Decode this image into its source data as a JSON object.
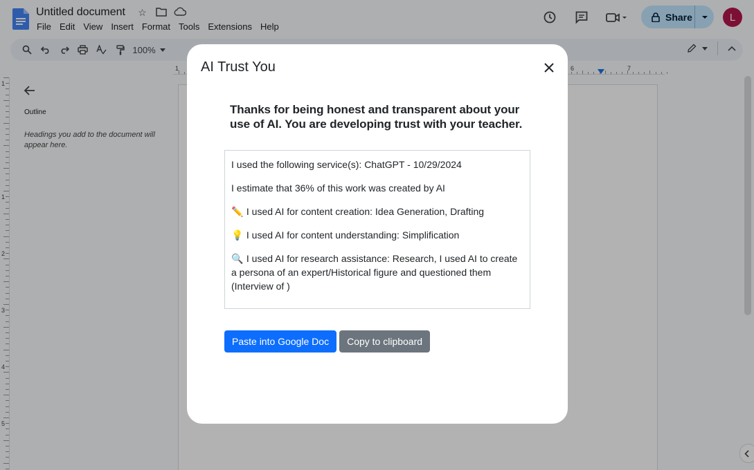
{
  "app": {
    "doc_title": "Untitled document",
    "menu": [
      "File",
      "Edit",
      "View",
      "Insert",
      "Format",
      "Tools",
      "Extensions",
      "Help"
    ],
    "share_label": "Share",
    "avatar_initial": "L",
    "zoom": "100%"
  },
  "outline": {
    "title": "Outline",
    "hint": "Headings you add to the document will appear here."
  },
  "ruler": {
    "top_ticks": [
      "1",
      "6",
      "7"
    ],
    "left_ticks": [
      "1",
      "1",
      "2",
      "3",
      "4",
      "5"
    ]
  },
  "modal": {
    "title": "AI Trust You",
    "lead": "Thanks for being honest and transparent about your use of AI. You are developing trust with your teacher.",
    "lines": [
      {
        "icon": "",
        "text": "I used the following service(s): ChatGPT - 10/29/2024"
      },
      {
        "icon": "",
        "text": "I estimate that 36% of this work was created by AI"
      },
      {
        "icon": "✏️",
        "text": "I used AI for content creation: Idea Generation, Drafting"
      },
      {
        "icon": "💡",
        "text": "I used AI for content understanding: Simplification"
      },
      {
        "icon": "🔍",
        "text": "I used AI for research assistance: Research, I used AI to create a persona of an expert/Historical figure and questioned them (Interview of )"
      }
    ],
    "paste_button": "Paste into Google Doc",
    "copy_button": "Copy to clipboard"
  },
  "colors": {
    "primary": "#0d6efd",
    "secondary": "#6c757d",
    "share_bg": "#c2e7ff",
    "avatar": "#b3164d",
    "docs_blue": "#4285f4"
  }
}
